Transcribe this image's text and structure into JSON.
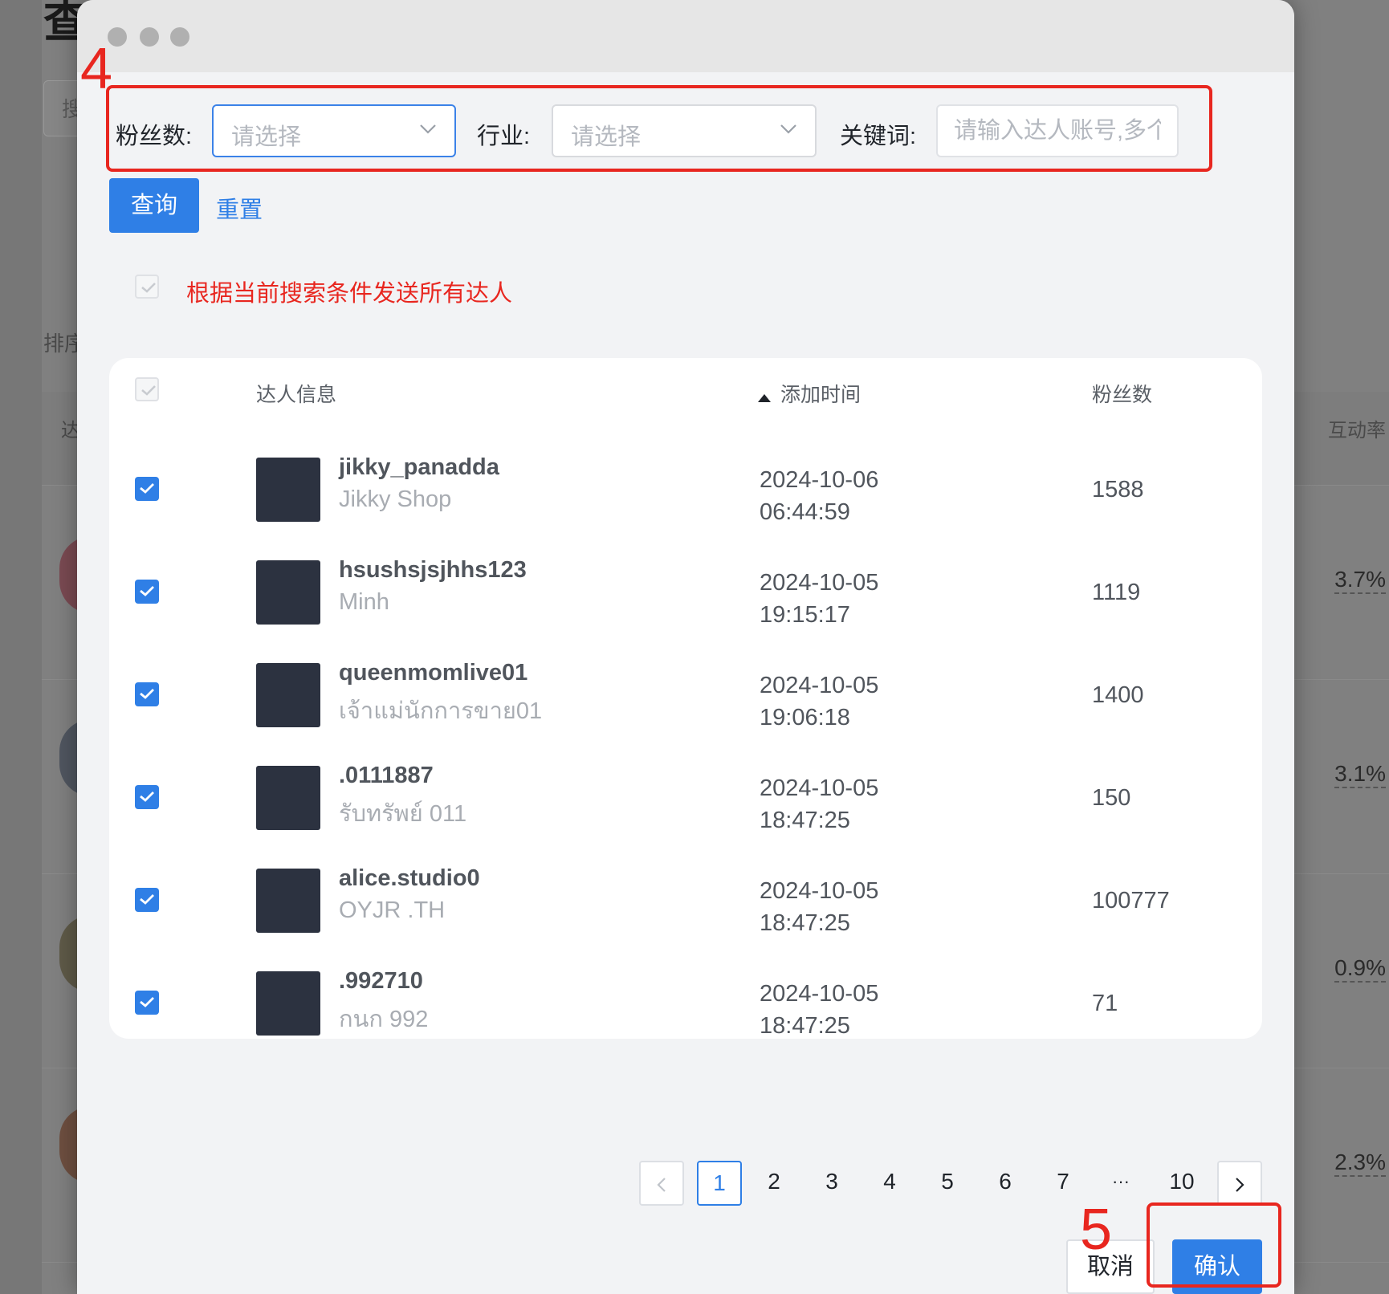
{
  "background": {
    "title_char": "查",
    "search_char": "搜",
    "sort_label": "排序",
    "col_first": "达",
    "col_rate": "互动率",
    "rates": [
      "3.7%",
      "3.1%",
      "0.9%",
      "2.3%"
    ]
  },
  "filters": {
    "fans_label": "粉丝数:",
    "fans_placeholder": "请选择",
    "industry_label": "行业:",
    "industry_placeholder": "请选择",
    "keyword_label": "关键词:",
    "keyword_placeholder": "请输入达人账号,多个"
  },
  "actions": {
    "query_label": "查询",
    "reset_label": "重置"
  },
  "send_all_label": "根据当前搜索条件发送所有达人",
  "table": {
    "headers": {
      "info": "达人信息",
      "added_time": "添加时间",
      "fans": "粉丝数"
    },
    "rows": [
      {
        "username": "jikky_panadda",
        "nickname": "Jikky Shop",
        "date": "2024-10-06",
        "time": "06:44:59",
        "fans": "1588"
      },
      {
        "username": "hsushsjsjhhs123",
        "nickname": "Minh",
        "date": "2024-10-05",
        "time": "19:15:17",
        "fans": "1119"
      },
      {
        "username": "queenmomlive01",
        "nickname": "เจ้าแม่นักการขาย01",
        "date": "2024-10-05",
        "time": "19:06:18",
        "fans": "1400"
      },
      {
        "username": ".0111887",
        "nickname": "รับทรัพย์ 011",
        "date": "2024-10-05",
        "time": "18:47:25",
        "fans": "150"
      },
      {
        "username": "alice.studio0",
        "nickname": "OYJR .TH",
        "date": "2024-10-05",
        "time": "18:47:25",
        "fans": "100777"
      },
      {
        "username": ".992710",
        "nickname": "กนก 992",
        "date": "2024-10-05",
        "time": "18:47:25",
        "fans": "71"
      }
    ]
  },
  "pagination": {
    "pages": [
      "1",
      "2",
      "3",
      "4",
      "5",
      "6",
      "7"
    ],
    "ellipsis": "···",
    "last": "10",
    "current": "1"
  },
  "footer": {
    "cancel_label": "取消",
    "confirm_label": "确认"
  },
  "annotations": {
    "step4": "4",
    "step5": "5",
    "color": "#e8261f"
  },
  "colors": {
    "primary": "#2f7fe6",
    "danger": "#e8261f"
  }
}
